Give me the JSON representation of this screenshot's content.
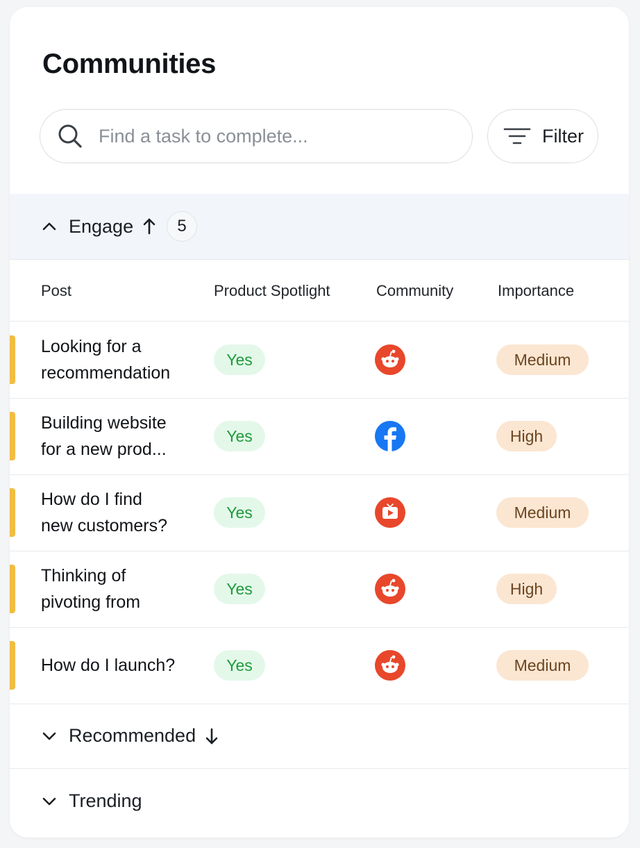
{
  "header": {
    "title": "Communities"
  },
  "search": {
    "placeholder": "Find a task to complete..."
  },
  "filter": {
    "label": "Filter"
  },
  "groups": {
    "engage": {
      "label": "Engage",
      "count": "5",
      "expanded": true
    },
    "recommended": {
      "label": "Recommended",
      "expanded": false
    },
    "trending": {
      "label": "Trending",
      "expanded": false
    }
  },
  "table": {
    "columns": [
      "Post",
      "Product Spotlight",
      "Community",
      "Importance"
    ],
    "rows": [
      {
        "post_line1": "Looking for a",
        "post_line2": "recommendation",
        "spotlight": "Yes",
        "community": "reddit-icon",
        "importance": "Medium"
      },
      {
        "post_line1": "Building website",
        "post_line2": "for a new prod...",
        "spotlight": "Yes",
        "community": "facebook-icon",
        "importance": "High"
      },
      {
        "post_line1": "How do I find",
        "post_line2": "new customers?",
        "spotlight": "Yes",
        "community": "youtube-icon",
        "importance": "Medium"
      },
      {
        "post_line1": "Thinking of",
        "post_line2": "pivoting from",
        "spotlight": "Yes",
        "community": "reddit-icon",
        "importance": "High"
      },
      {
        "post_line1": "How do I launch?",
        "post_line2": "",
        "spotlight": "Yes",
        "community": "reddit-icon",
        "importance": "Medium"
      }
    ]
  },
  "colors": {
    "accent_bar": "#f1bd42",
    "yes_bg": "#e4f8ea",
    "yes_text": "#1f9a3a",
    "importance_bg": "#fbe6d2",
    "reddit": "#e8472b",
    "facebook": "#1877f2",
    "youtube": "#e8472b"
  }
}
